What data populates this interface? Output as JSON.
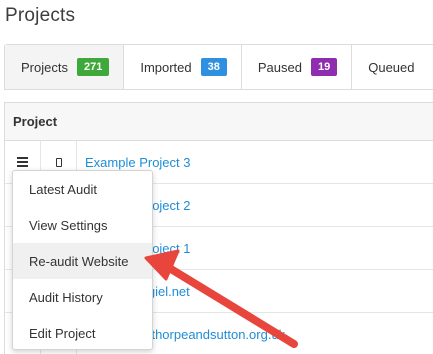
{
  "page": {
    "title": "Projects"
  },
  "tabs": [
    {
      "label": "Projects",
      "count": "271",
      "color": "#3fa83a"
    },
    {
      "label": "Imported",
      "count": "38",
      "color": "#2f8fe0"
    },
    {
      "label": "Paused",
      "count": "19",
      "color": "#8f2db0"
    },
    {
      "label": "Queued",
      "count": "",
      "color": ""
    }
  ],
  "table": {
    "header": "Project",
    "rows": [
      {
        "name": "Example Project 3"
      },
      {
        "name": "Example Project 2"
      },
      {
        "name": "Example Project 1"
      },
      {
        "name": "www.leigh-giel.net"
      },
      {
        "name": "www.mablethorpeandsutton.org.uk"
      }
    ]
  },
  "dropdown": {
    "items": [
      "Latest Audit",
      "View Settings",
      "Re-audit Website",
      "Audit History",
      "Edit Project"
    ],
    "highlighted_index": 2
  },
  "annotation": {
    "arrow_color": "#e8453c"
  }
}
